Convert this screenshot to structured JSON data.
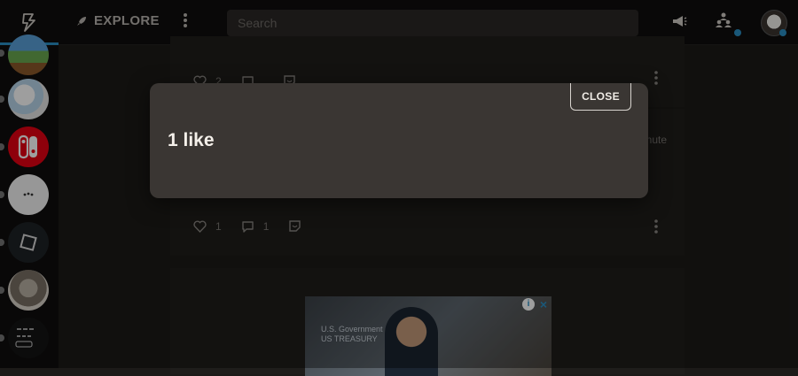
{
  "header": {
    "explore_label": "EXPLORE",
    "search_placeholder": "Search"
  },
  "feed": {
    "post1": {
      "like_count": "2"
    },
    "post2": {
      "time_fragment": "inute",
      "like_count": "1",
      "comment_count": "1"
    },
    "ad": {
      "text_line1": "U.S. Government",
      "text_line2": "US TREASURY"
    }
  },
  "modal": {
    "title": "1 like",
    "close_label": "CLOSE"
  },
  "colors": {
    "accent": "#2a8fc4",
    "modal_bg": "#3a3633",
    "topbar_bg": "#0f0e0d"
  }
}
